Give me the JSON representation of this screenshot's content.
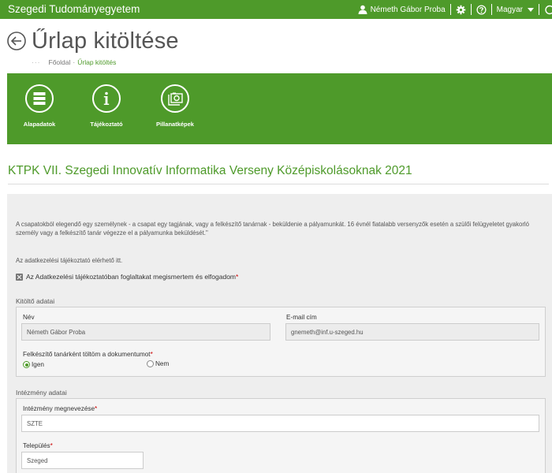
{
  "topbar": {
    "brand": "Szegedi Tudományegyetem",
    "user_name": "Németh Gábor Proba",
    "language": "Magyar"
  },
  "page": {
    "title": "Űrlap kitöltése"
  },
  "breadcrumb": {
    "dots": "···",
    "home": "Főoldal",
    "separator": "·",
    "current": "Űrlap kitöltés"
  },
  "nav": {
    "items": [
      {
        "label": "Alapadatok",
        "icon": "list-icon"
      },
      {
        "label": "Tájékoztató",
        "icon": "info-icon"
      },
      {
        "label": "Pillanatképek",
        "icon": "gallery-icon"
      }
    ]
  },
  "form": {
    "heading": "KTPK VII. Szegedi Innovatív Informatika Verseny Középiskolásoknak 2021",
    "intro": "A csapatokból elegendő egy személynek - a csapat egy tagjának, vagy a felkészítő tanárnak - beküldenie a pályamunkát. 16 évnél fiatalabb versenyzők esetén a szülői felügyeletet gyakorló személy vagy a felkészítő tanár végezze el a pályamunka beküldését.\"",
    "privacy_note": "Az adatkezelési tájékoztató elérhető itt.",
    "consent_label": "Az Adatkezelési tájékoztatóban foglaltakat megismertem és elfogadom",
    "required_mark": "*",
    "filler": {
      "legend": "Kitöltő adatai",
      "name_label": "Név",
      "name_value": "Németh Gábor Proba",
      "email_label": "E-mail cím",
      "email_value": "gnemeth@inf.u-szeged.hu",
      "teacher_question": "Felkészítő tanárként töltöm a dokumentumot",
      "option_yes": "Igen",
      "option_no": "Nem"
    },
    "institution": {
      "legend": "Intézmény adatai",
      "name_label": "Intézmény megnevezése",
      "name_value": "SZTE",
      "city_label": "Település",
      "city_value": "Szeged"
    }
  },
  "colors": {
    "brand_green": "#4e9a2a",
    "required_red": "#cc0000"
  }
}
